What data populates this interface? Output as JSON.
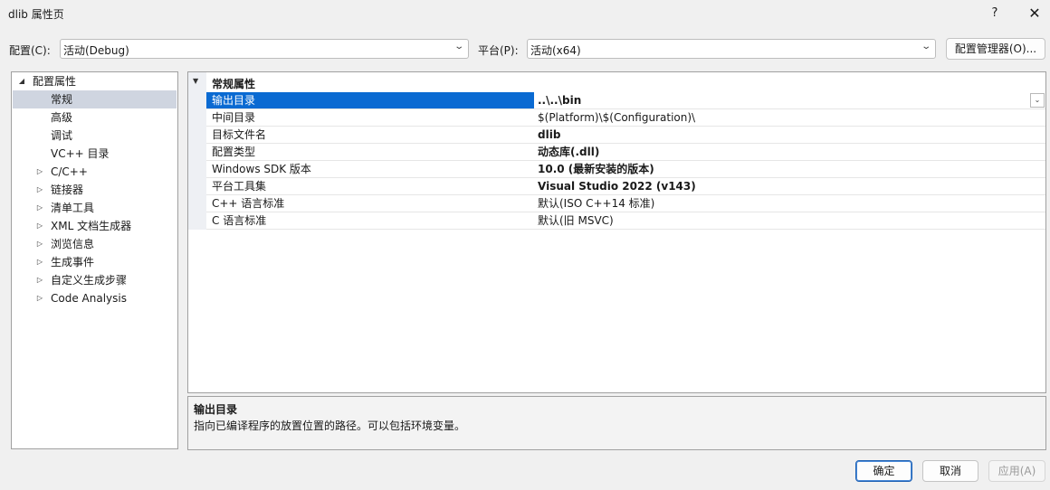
{
  "window": {
    "title": "dlib 属性页",
    "help_label": "?",
    "close_label": "✕"
  },
  "toolbar": {
    "config_label": "配置(C):",
    "config_value": "活动(Debug)",
    "platform_label": "平台(P):",
    "platform_value": "活动(x64)",
    "config_manager_label": "配置管理器(O)..."
  },
  "tree": {
    "root_label": "配置属性",
    "items": [
      {
        "label": "常规",
        "expandable": false,
        "selected": true
      },
      {
        "label": "高级",
        "expandable": false
      },
      {
        "label": "调试",
        "expandable": false
      },
      {
        "label": "VC++ 目录",
        "expandable": false
      },
      {
        "label": "C/C++",
        "expandable": true
      },
      {
        "label": "链接器",
        "expandable": true
      },
      {
        "label": "清单工具",
        "expandable": true
      },
      {
        "label": "XML 文档生成器",
        "expandable": true
      },
      {
        "label": "浏览信息",
        "expandable": true
      },
      {
        "label": "生成事件",
        "expandable": true
      },
      {
        "label": "自定义生成步骤",
        "expandable": true
      },
      {
        "label": "Code Analysis",
        "expandable": true
      }
    ]
  },
  "grid": {
    "category": "常规属性",
    "rows": [
      {
        "name": "输出目录",
        "value": "..\\..\\bin",
        "bold": true,
        "selected": true
      },
      {
        "name": "中间目录",
        "value": "$(Platform)\\$(Configuration)\\",
        "bold": false
      },
      {
        "name": "目标文件名",
        "value": "dlib",
        "bold": true
      },
      {
        "name": "配置类型",
        "value": "动态库(.dll)",
        "bold": true
      },
      {
        "name": "Windows SDK 版本",
        "value": "10.0 (最新安装的版本)",
        "bold": true
      },
      {
        "name": "平台工具集",
        "value": "Visual Studio 2022 (v143)",
        "bold": true
      },
      {
        "name": "C++ 语言标准",
        "value": "默认(ISO C++14 标准)",
        "bold": false
      },
      {
        "name": "C 语言标准",
        "value": "默认(旧 MSVC)",
        "bold": false
      }
    ]
  },
  "description": {
    "title": "输出目录",
    "text": "指向已编译程序的放置位置的路径。可以包括环境变量。"
  },
  "buttons": {
    "ok": "确定",
    "cancel": "取消",
    "apply": "应用(A)"
  },
  "icons": {
    "dropdown": "chevron-down-icon",
    "tree_expanded": "triangle-down-icon",
    "tree_collapsed": "triangle-right-icon"
  },
  "colors": {
    "selection": "#0a6ad2",
    "tree_selection": "#cfd5e0",
    "primary_border": "#1e61b3"
  }
}
